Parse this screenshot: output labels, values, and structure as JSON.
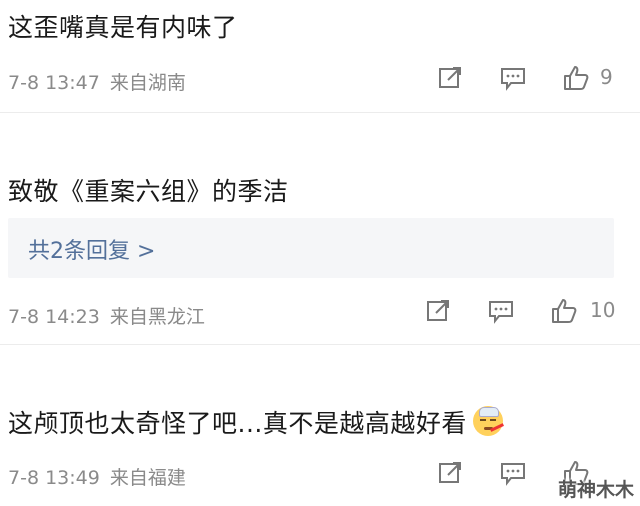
{
  "comments": [
    {
      "text": "这歪嘴真是有内味了",
      "date": "7-8 13:47",
      "location": "来自湖南",
      "likes": "9"
    },
    {
      "text": "致敬《重案六组》的季洁",
      "replies_label": "共2条回复 >",
      "date": "7-8 14:23",
      "location": "来自黑龙江",
      "likes": "10"
    },
    {
      "text": "这颅顶也太奇怪了吧...真不是越高越好看",
      "date": "7-8 13:49",
      "location": "来自福建",
      "likes": ""
    }
  ],
  "icons": {
    "share": "share-icon",
    "comment": "comment-icon",
    "like": "thumbs-up-icon",
    "emoji": "sick-thermometer-emoji-icon"
  },
  "watermark": "萌神木木",
  "colors": {
    "text": "#1a1a1a",
    "meta": "#8a8a8a",
    "reply_link": "#53709a",
    "reply_bg": "#f5f6f8",
    "divider": "#ececec"
  }
}
